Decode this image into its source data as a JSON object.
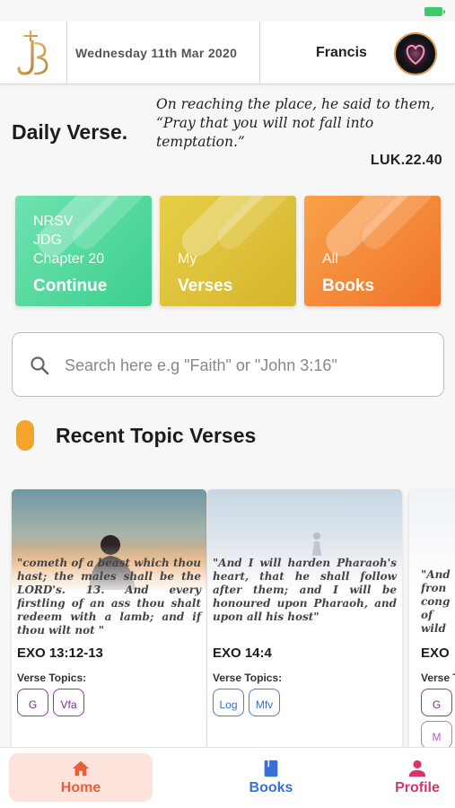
{
  "header": {
    "date": "Wednesday 11th Mar 2020",
    "user_name": "Francis"
  },
  "daily_verse": {
    "title": "Daily Verse.",
    "text": "On reaching the place, he said to them, “Pray that you will not fall into temptation.”",
    "reference": "LUK.22.40"
  },
  "cards": [
    {
      "lines": [
        "NRSV",
        "JDG",
        "Chapter 20"
      ],
      "action": "Continue",
      "color": "#3ccf8e"
    },
    {
      "lines": [
        "My"
      ],
      "action": "Verses",
      "color": "#d5b52a"
    },
    {
      "lines": [
        "All"
      ],
      "action": "Books",
      "color": "#f0732a"
    }
  ],
  "search": {
    "placeholder": "Search here e.g \"Faith\" or \"John 3:16\""
  },
  "recent": {
    "title": "Recent Topic Verses",
    "accent_color": "#f3a42c",
    "topics_label": "Verse Topics:",
    "items": [
      {
        "text": "\"cometh of a beast which thou hast; the males shall be the LORD's. 13. And every firstling of an ass thou shalt redeem with a lamb; and if thou wilt not \"",
        "reference": "EXO 13:12-13",
        "topics": [
          "G",
          "Vfa"
        ]
      },
      {
        "text": "\"And I will harden Pharaoh's heart, that he shall follow after them; and I will be honoured upon Pharaoh, and upon all his host\"",
        "reference": "EXO 14:4",
        "topics": [
          "Log",
          "Mfv"
        ]
      },
      {
        "text": "\"And fron cong of wild",
        "reference": "EXO",
        "topics": [
          "G",
          "M"
        ]
      }
    ]
  },
  "tabs": [
    {
      "label": "Home",
      "color": "#e8603a",
      "icon": "home-icon"
    },
    {
      "label": "Books",
      "color": "#3a6fd8",
      "icon": "book-icon"
    },
    {
      "label": "Profile",
      "color": "#d8336a",
      "icon": "person-icon"
    }
  ]
}
